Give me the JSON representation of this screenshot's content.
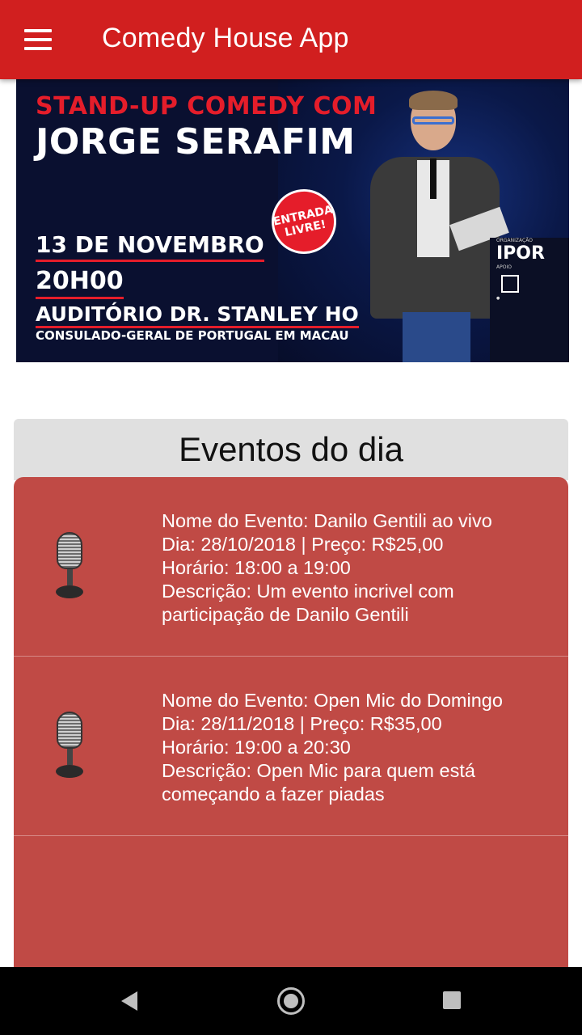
{
  "appbar": {
    "title": "Comedy House App",
    "menu_icon": "hamburger-menu-icon",
    "color": "#d11f1f"
  },
  "banner": {
    "line1": "STAND-UP COMEDY COM",
    "line2": "JORGE SERAFIM",
    "badge": "ENTRADA LIVRE!",
    "date": "13 DE NOVEMBRO",
    "time": "20H00",
    "venue": "AUDITÓRIO DR. STANLEY HO",
    "consulate": "CONSULADO-GERAL DE PORTUGAL EM MACAU",
    "sponsor_org_label": "ORGANIZAÇÃO",
    "sponsor_org": "IPOR",
    "sponsor_support_label": "APOIO"
  },
  "panel": {
    "title": "Eventos do dia",
    "list_color": "#c04a45"
  },
  "events": [
    {
      "icon": "microphone-icon",
      "name": "Nome do Evento: Danilo Gentili ao vivo",
      "date_price": "Dia: 28/10/2018 | Preço: R$25,00",
      "time": "Horário: 18:00 a 19:00",
      "desc1": "Descrição: Um evento incrivel com",
      "desc2": "participação de Danilo Gentili"
    },
    {
      "icon": "microphone-icon",
      "name": "Nome do Evento: Open Mic do Domingo",
      "date_price": "Dia: 28/11/2018 | Preço: R$35,00",
      "time": "Horário: 19:00 a 20:30",
      "desc1": "Descrição: Open Mic para quem está",
      "desc2": "começando a fazer piadas"
    }
  ],
  "navbar": {
    "back_icon": "back-triangle-icon",
    "home_icon": "home-circle-icon",
    "recent_icon": "recent-apps-square-icon"
  }
}
